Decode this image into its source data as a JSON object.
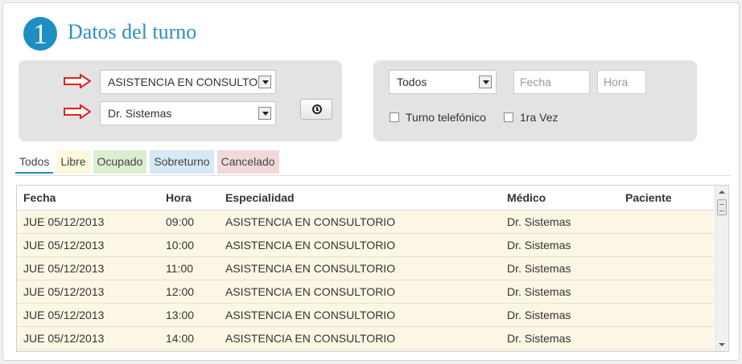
{
  "header": {
    "step_number": "1",
    "title": "Datos del turno"
  },
  "filters_left": {
    "specialty_select": "ASISTENCIA EN CONSULTO",
    "doctor_select": "Dr. Sistemas",
    "clock_icon": "clock-icon",
    "arrow_icon": "red-arrow-right-icon"
  },
  "filters_right": {
    "status_select": "Todos",
    "fecha_placeholder": "Fecha",
    "hora_placeholder": "Hora",
    "checkbox_phone_label": "Turno telefónico",
    "checkbox_first_label": "1ra Vez"
  },
  "tabs": [
    {
      "label": "Todos"
    },
    {
      "label": "Libre"
    },
    {
      "label": "Ocupado"
    },
    {
      "label": "Sobreturno"
    },
    {
      "label": "Cancelado"
    }
  ],
  "table": {
    "headers": [
      "Fecha",
      "Hora",
      "Especialidad",
      "Médico",
      "Paciente"
    ],
    "rows": [
      [
        "JUE 05/12/2013",
        "09:00",
        "ASISTENCIA EN CONSULTORIO",
        "Dr. Sistemas",
        ""
      ],
      [
        "JUE 05/12/2013",
        "10:00",
        "ASISTENCIA EN CONSULTORIO",
        "Dr. Sistemas",
        ""
      ],
      [
        "JUE 05/12/2013",
        "11:00",
        "ASISTENCIA EN CONSULTORIO",
        "Dr. Sistemas",
        ""
      ],
      [
        "JUE 05/12/2013",
        "12:00",
        "ASISTENCIA EN CONSULTORIO",
        "Dr. Sistemas",
        ""
      ],
      [
        "JUE 05/12/2013",
        "13:00",
        "ASISTENCIA EN CONSULTORIO",
        "Dr. Sistemas",
        ""
      ],
      [
        "JUE 05/12/2013",
        "14:00",
        "ASISTENCIA EN CONSULTORIO",
        "Dr. Sistemas",
        ""
      ]
    ]
  },
  "colors": {
    "accent": "#1e8fc3",
    "row_background": "#fcf7e4",
    "tab_libre": "#fdf7dc",
    "tab_ocupado": "#dbeed2",
    "tab_sobreturno": "#d6e9f4",
    "tab_cancelado": "#f2d8d8",
    "annotation_arrow": "#e02020"
  }
}
